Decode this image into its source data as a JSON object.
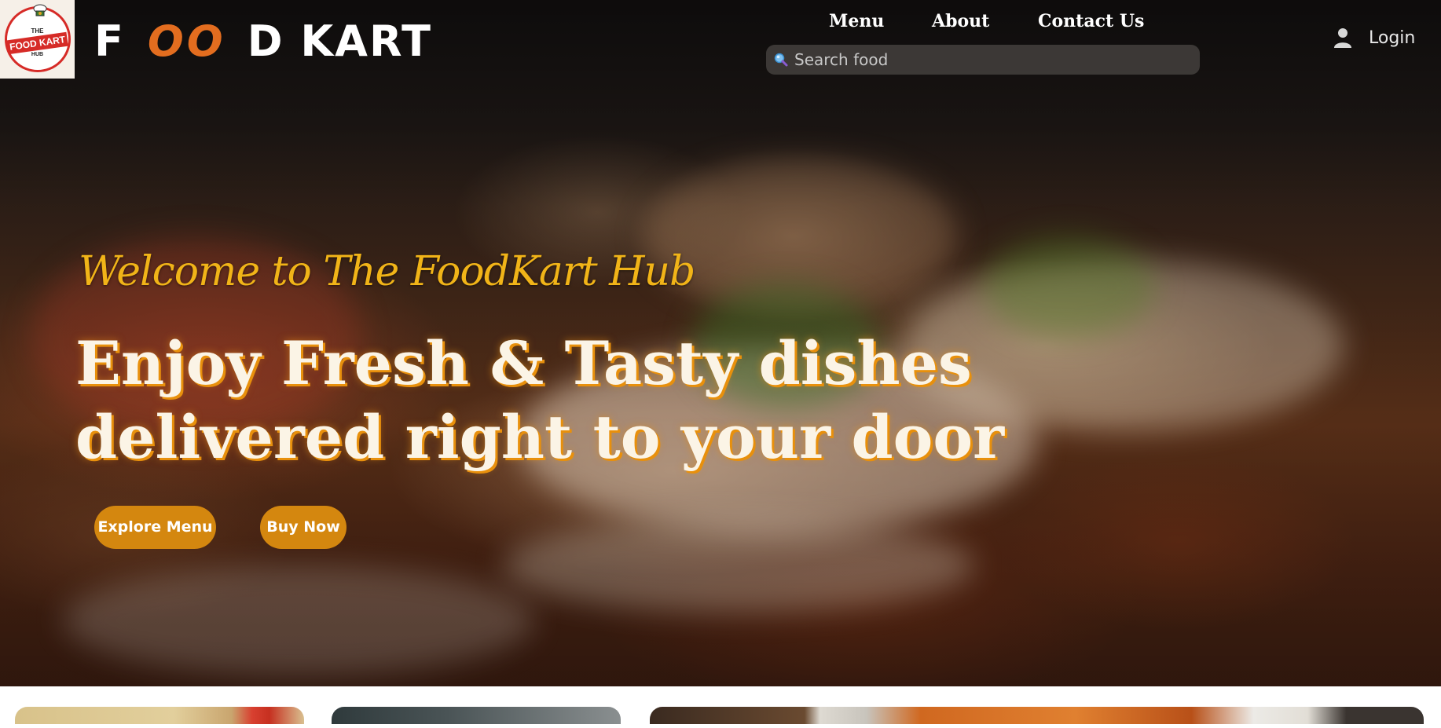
{
  "brand": {
    "logo_top": "THE",
    "logo_band": "FOOD KART",
    "logo_bottom": "HUB",
    "name_f": "F",
    "name_o1": "O",
    "name_o2": "O",
    "name_rest": "D KART"
  },
  "nav": {
    "links": [
      "Menu",
      "About",
      "Contact Us"
    ],
    "login_label": "Login"
  },
  "search": {
    "placeholder": "Search food",
    "value": ""
  },
  "hero": {
    "welcome": "Welcome to The FoodKart Hub",
    "headline_line1": "Enjoy Fresh & Tasty dishes",
    "headline_line2": "delivered right to your door",
    "buttons": [
      "Explore Menu",
      "Buy Now"
    ]
  },
  "colors": {
    "accent": "#d4870f",
    "welcome_text": "#f1b418",
    "brand_o": "#e36d1f",
    "logo_red": "#d62b27"
  },
  "icons": {
    "search": "search-icon",
    "login": "user-icon"
  }
}
